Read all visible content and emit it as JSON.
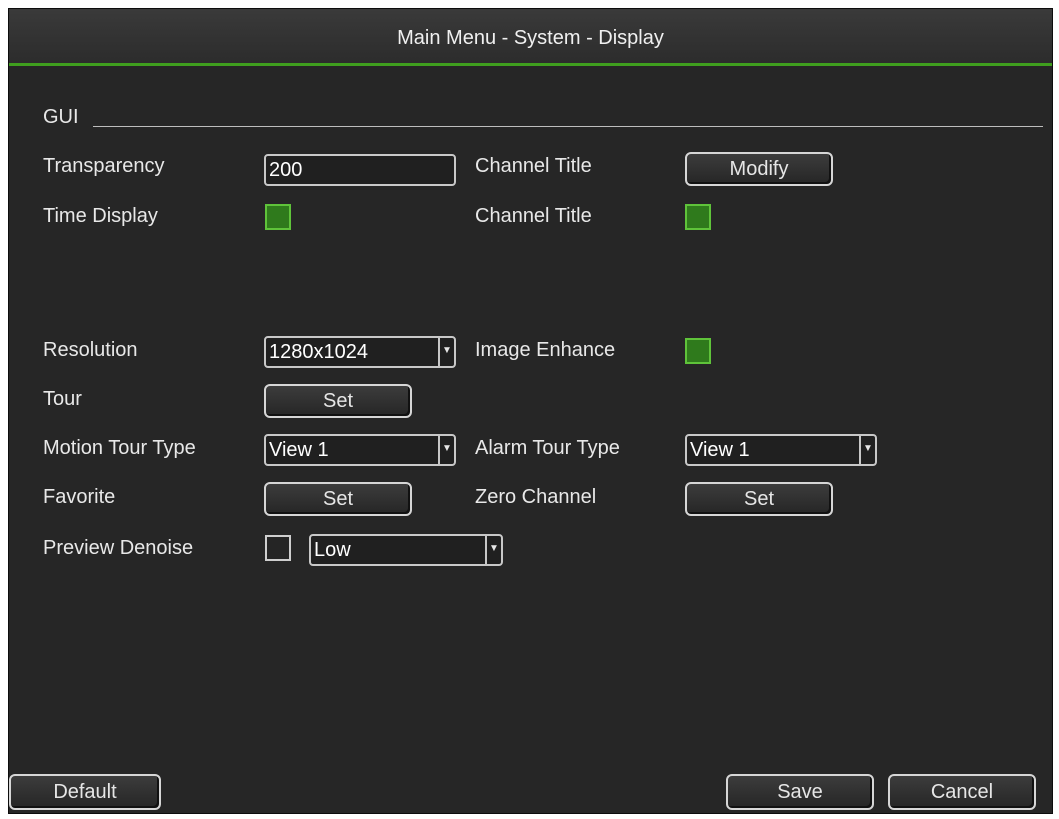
{
  "window": {
    "title": "Main Menu - System - Display"
  },
  "gui": {
    "section_label": "GUI",
    "transparency": {
      "label": "Transparency",
      "value": "200"
    },
    "channel_title_modify": {
      "label": "Channel Title",
      "button": "Modify"
    },
    "time_display": {
      "label": "Time Display",
      "checked": true
    },
    "channel_title_toggle": {
      "label": "Channel Title",
      "checked": true
    },
    "resolution": {
      "label": "Resolution",
      "value": "1280x1024"
    },
    "image_enhance": {
      "label": "Image Enhance",
      "checked": true
    },
    "tour": {
      "label": "Tour",
      "button": "Set"
    },
    "motion_tour_type": {
      "label": "Motion Tour Type",
      "value": "View 1"
    },
    "alarm_tour_type": {
      "label": "Alarm Tour Type",
      "value": "View 1"
    },
    "favorite": {
      "label": "Favorite",
      "button": "Set"
    },
    "zero_channel": {
      "label": "Zero Channel",
      "button": "Set"
    },
    "preview_denoise": {
      "label": "Preview Denoise",
      "checked": false,
      "value": "Low"
    }
  },
  "footer": {
    "default": "Default",
    "save": "Save",
    "cancel": "Cancel"
  },
  "colors": {
    "accent": "#3f9e1e",
    "check_on": "#2f7a1c",
    "background": "#262626"
  },
  "icons": {
    "dropdown": "chevron-down-icon"
  }
}
